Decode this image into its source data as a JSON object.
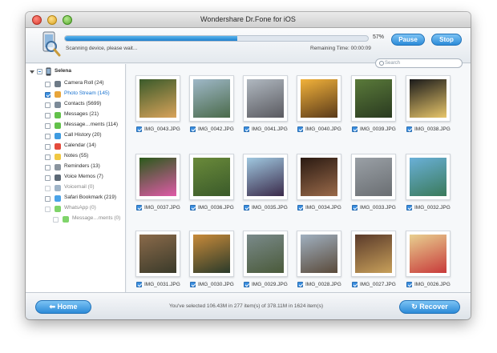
{
  "window": {
    "title": "Wondershare Dr.Fone for iOS"
  },
  "toolbar": {
    "progress": 0.57,
    "percent_label": "57%",
    "status": "Scanning device, please wait...",
    "remaining": "Remaining Time:  00:00:09",
    "pause_label": "Pause",
    "stop_label": "Stop"
  },
  "search": {
    "placeholder": "Search"
  },
  "sidebar": {
    "device": "Selena",
    "items": [
      {
        "label": "Camera Roll (24)",
        "icon": "camera-icon",
        "color": "#6d7a86",
        "state": "unchecked"
      },
      {
        "label": "Photo Stream (145)",
        "icon": "photo-stream-icon",
        "color": "#e8a53a",
        "state": "checked",
        "selected": true
      },
      {
        "label": "Contacts (5699)",
        "icon": "contacts-icon",
        "color": "#7c8a98",
        "state": "unchecked"
      },
      {
        "label": "Messages (21)",
        "icon": "messages-icon",
        "color": "#62c14a",
        "state": "unchecked"
      },
      {
        "label": "Message…ments (114)",
        "icon": "message-attachments-icon",
        "color": "#62c14a",
        "state": "unchecked"
      },
      {
        "label": "Call History (20)",
        "icon": "call-history-icon",
        "color": "#3f9be0",
        "state": "unchecked"
      },
      {
        "label": "Calendar (14)",
        "icon": "calendar-icon",
        "color": "#e44b3b",
        "state": "unchecked"
      },
      {
        "label": "Notes (55)",
        "icon": "notes-icon",
        "color": "#f0c842",
        "state": "unchecked"
      },
      {
        "label": "Reminders (13)",
        "icon": "reminders-icon",
        "color": "#8a949e",
        "state": "unchecked"
      },
      {
        "label": "Voice Memos (7)",
        "icon": "voice-memos-icon",
        "color": "#5b6875",
        "state": "unchecked"
      },
      {
        "label": "Voicemail (0)",
        "icon": "voicemail-icon",
        "color": "#9fb4c8",
        "state": "unchecked",
        "dim": true
      },
      {
        "label": "Safari Bookmark (219)",
        "icon": "safari-bookmark-icon",
        "color": "#4aa3e8",
        "state": "unchecked"
      },
      {
        "label": "WhatsApp (0)",
        "icon": "whatsapp-icon",
        "color": "#7fd46a",
        "state": "unchecked",
        "dim": true
      },
      {
        "label": "Message…ments (0)",
        "icon": "whatsapp-attachments-icon",
        "color": "#7fd46a",
        "state": "unchecked",
        "dim": true,
        "indent": true
      }
    ]
  },
  "photos": [
    {
      "name": "IMG_0043.JPG",
      "colors": [
        "#3a5a2a",
        "#d9a35a"
      ]
    },
    {
      "name": "IMG_0042.JPG",
      "colors": [
        "#9fb8c8",
        "#4a6a4a"
      ]
    },
    {
      "name": "IMG_0041.JPG",
      "colors": [
        "#b0b8c0",
        "#5a5a60"
      ]
    },
    {
      "name": "IMG_0040.JPG",
      "colors": [
        "#f2b23a",
        "#5a3a1a"
      ]
    },
    {
      "name": "IMG_0039.JPG",
      "colors": [
        "#5a7a3a",
        "#2a3a20"
      ]
    },
    {
      "name": "IMG_0038.JPG",
      "colors": [
        "#1a1a1a",
        "#e8c66a"
      ]
    },
    {
      "name": "IMG_0037.JPG",
      "colors": [
        "#2a5a1a",
        "#e05aa8"
      ]
    },
    {
      "name": "IMG_0036.JPG",
      "colors": [
        "#6a8a3a",
        "#3a5a2a"
      ]
    },
    {
      "name": "IMG_0035.JPG",
      "colors": [
        "#a0c8e0",
        "#3a2a4a"
      ]
    },
    {
      "name": "IMG_0034.JPG",
      "colors": [
        "#2a1a12",
        "#9a6a4a"
      ]
    },
    {
      "name": "IMG_0033.JPG",
      "colors": [
        "#9aa0a6",
        "#6a6e72"
      ]
    },
    {
      "name": "IMG_0032.JPG",
      "colors": [
        "#6ab0d8",
        "#3a7a5a"
      ]
    },
    {
      "name": "IMG_0031.JPG",
      "colors": [
        "#8a6a4a",
        "#3a3a2a"
      ]
    },
    {
      "name": "IMG_0030.JPG",
      "colors": [
        "#c88a3a",
        "#2a3a2a"
      ]
    },
    {
      "name": "IMG_0029.JPG",
      "colors": [
        "#7a8a8a",
        "#4a5a3a"
      ]
    },
    {
      "name": "IMG_0028.JPG",
      "colors": [
        "#a0b0c0",
        "#5a4a3a"
      ]
    },
    {
      "name": "IMG_0027.JPG",
      "colors": [
        "#5a3a2a",
        "#c8a05a"
      ]
    },
    {
      "name": "IMG_0026.JPG",
      "colors": [
        "#e8d090",
        "#c83a3a"
      ]
    }
  ],
  "footer": {
    "home_label": "Home",
    "recover_label": "Recover",
    "selected_info": "You've selected 106.43M in 277 item(s) of 378.11M in 1624 item(s)"
  },
  "colors": {
    "accent": "#2c8bd8"
  }
}
